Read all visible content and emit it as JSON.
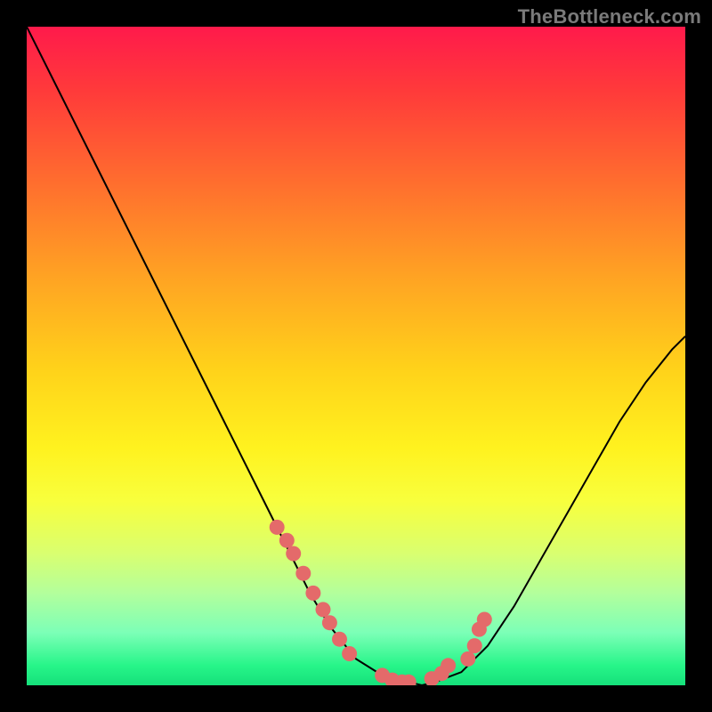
{
  "watermark": "TheBottleneck.com",
  "colors": {
    "page_bg": "#000000",
    "curve": "#000000",
    "marker": "#e46a6a",
    "gradient_top": "#ff1a4b",
    "gradient_bottom": "#15e07a"
  },
  "chart_data": {
    "type": "line",
    "title": "",
    "xlabel": "",
    "ylabel": "",
    "xlim": [
      0,
      100
    ],
    "ylim": [
      0,
      100
    ],
    "grid": false,
    "legend": false,
    "annotations": [
      "TheBottleneck.com"
    ],
    "series": [
      {
        "name": "bottleneck-curve",
        "x": [
          0,
          5,
          10,
          15,
          20,
          25,
          30,
          35,
          40,
          43,
          46,
          50,
          54,
          58,
          60,
          62,
          66,
          70,
          74,
          78,
          82,
          86,
          90,
          94,
          98,
          100
        ],
        "y": [
          100,
          90,
          80,
          70,
          60,
          50,
          40,
          30,
          20,
          14,
          9,
          4,
          1.5,
          0.5,
          0,
          0.5,
          2,
          6,
          12,
          19,
          26,
          33,
          40,
          46,
          51,
          53
        ]
      }
    ],
    "markers": {
      "name": "highlighted-points",
      "x": [
        38,
        39.5,
        40.5,
        42,
        43.5,
        45,
        46,
        47.5,
        49,
        54,
        55.5,
        57,
        58,
        61.5,
        63,
        64,
        67,
        68,
        68.7,
        69.5
      ],
      "y": [
        24,
        22,
        20,
        17,
        14,
        11.5,
        9.5,
        7,
        4.8,
        1.5,
        0.8,
        0.5,
        0.5,
        1,
        1.8,
        3,
        4,
        6,
        8.5,
        10
      ]
    }
  }
}
